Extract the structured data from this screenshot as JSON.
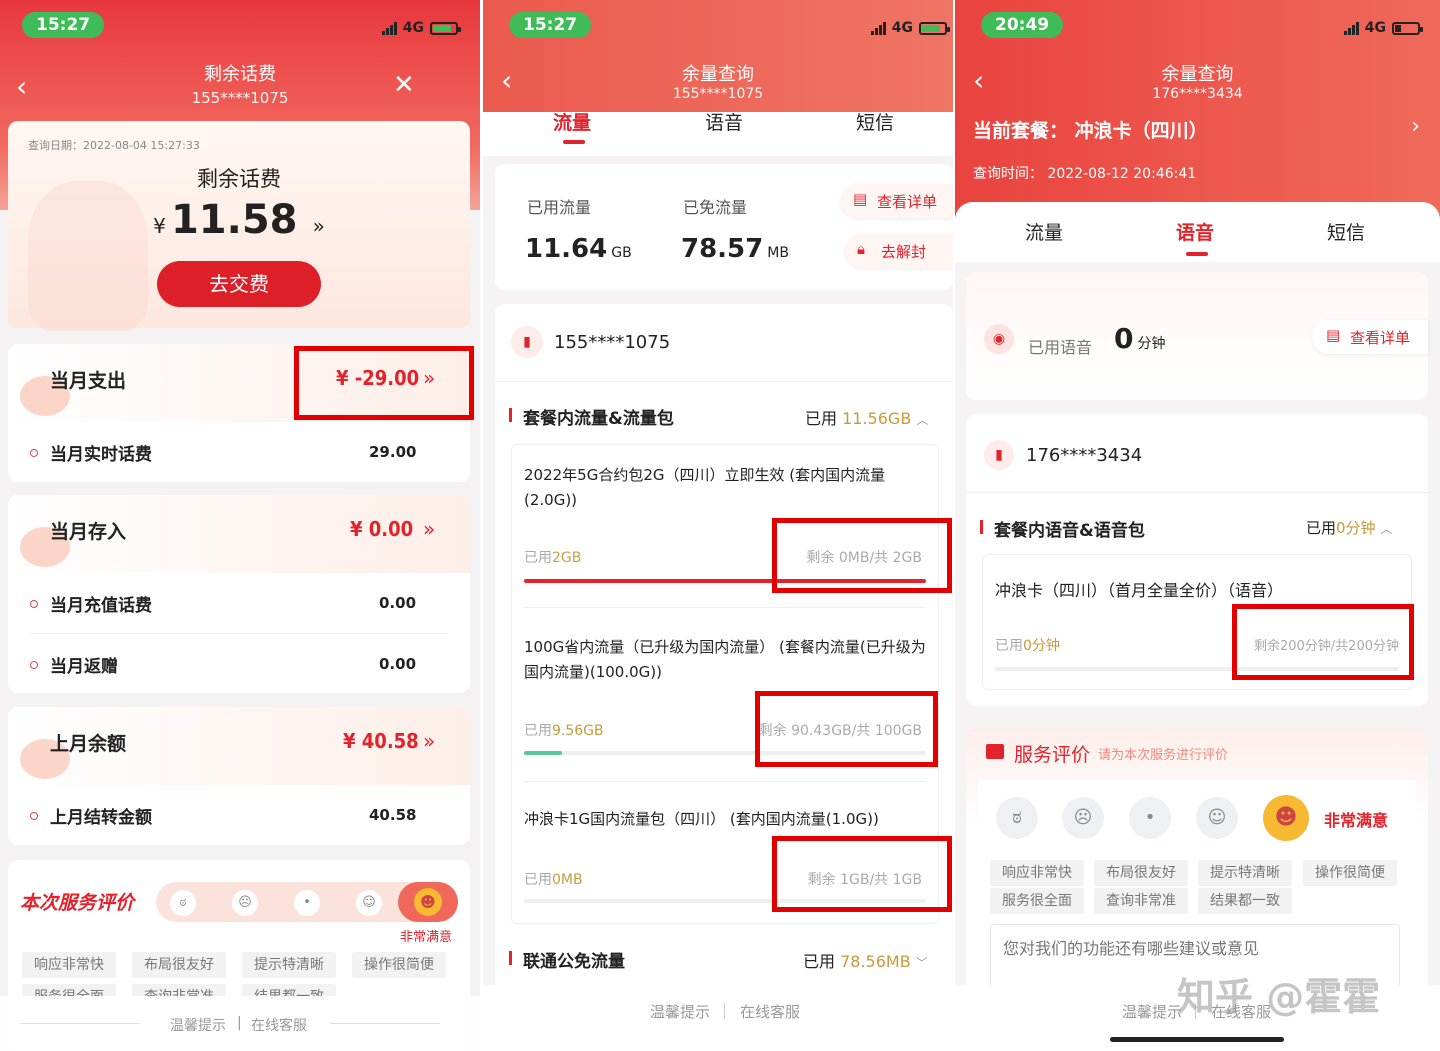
{
  "panel1": {
    "status": {
      "time": "15:27",
      "network": "4G"
    },
    "nav": {
      "title": "剩余话费",
      "number": "155****1075"
    },
    "balance": {
      "query_date": "查询日期：2022-08-04 15:27:33",
      "title": "剩余话费",
      "currency": "¥",
      "amount": "11.58",
      "pay_button": "去交费"
    },
    "expense": {
      "title": "当月支出",
      "amount": "¥  -29.00",
      "items": [
        {
          "label": "当月实时话费",
          "value": "29.00"
        }
      ]
    },
    "deposit": {
      "title": "当月存入",
      "amount": "¥  0.00",
      "items": [
        {
          "label": "当月充值话费",
          "value": "0.00"
        },
        {
          "label": "当月返赠",
          "value": "0.00"
        }
      ]
    },
    "last_month": {
      "title": "上月余额",
      "amount": "¥  40.58",
      "items": [
        {
          "label": "上月结转金额",
          "value": "40.58"
        }
      ]
    },
    "rating": {
      "title": "本次服务评价",
      "selected_label": "非常满意",
      "tags": [
        "响应非常快",
        "布局很友好",
        "提示特清晰",
        "操作很简便",
        "服务很全面",
        "查询非常准",
        "结果都一致"
      ]
    },
    "footer": {
      "tip": "温馨提示",
      "divider": "|",
      "service": "在线客服"
    }
  },
  "panel2": {
    "status": {
      "time": "15:27",
      "network": "4G"
    },
    "nav": {
      "title": "余量查询",
      "number": "155****1075"
    },
    "tabs": [
      "流量",
      "语音",
      "短信"
    ],
    "summary": {
      "used_label": "已用流量",
      "used_value": "11.64",
      "used_unit": "GB",
      "free_label": "已免流量",
      "free_value": "78.57",
      "free_unit": "MB",
      "detail_button": "查看详单",
      "unlock_button": "去解封"
    },
    "number": "155****1075",
    "section": {
      "title": "套餐内流量&流量包",
      "used_label": "已用",
      "used_value": "11.56GB"
    },
    "packages": [
      {
        "name": "2022年5G合约包2G（四川）立即生效 (套内国内流量(2.0G))",
        "used_label": "已用",
        "used_value": "2GB",
        "remain": "剩余 0MB/共 2GB",
        "ratio": 1.0,
        "color": "#e3232c"
      },
      {
        "name": "100G省内流量（已升级为国内流量） (套餐内流量(已升级为国内流量)(100.0G))",
        "used_label": "已用",
        "used_value": "9.56GB",
        "remain": "剩余 90.43GB/共 100GB",
        "ratio": 0.0956,
        "color": "#5cc59a"
      },
      {
        "name": "冲浪卡1G国内流量包（四川） (套内国内流量(1.0G))",
        "used_label": "已用",
        "used_value": "0MB",
        "remain": "剩余 1GB/共 1GB",
        "ratio": 0,
        "color": "#e3232c"
      }
    ],
    "section2": {
      "title": "联通公免流量",
      "used_label": "已用",
      "used_value": "78.56MB"
    },
    "footer": {
      "tip": "温馨提示",
      "service": "在线客服"
    }
  },
  "panel3": {
    "status": {
      "time": "20:49",
      "network": "4G"
    },
    "nav": {
      "title": "余量查询",
      "number": "176****3434"
    },
    "plan": {
      "label": "当前套餐：",
      "name": "冲浪卡（四川）"
    },
    "query_time": "查询时间：  2022-08-12 20:46:41",
    "tabs": [
      "流量",
      "语音",
      "短信"
    ],
    "summary": {
      "used_label": "已用语音",
      "used_value": "0",
      "used_unit": "分钟",
      "detail_button": "查看详单"
    },
    "number": "176****3434",
    "section": {
      "title": "套餐内语音&语音包",
      "used_label": "已用",
      "used_value": "0分钟"
    },
    "package": {
      "name": "冲浪卡（四川）（首月全量全价）（语音）",
      "used_label": "已用",
      "used_value": "0分钟",
      "remain": "剩余200分钟/共200分钟"
    },
    "rating": {
      "title": "服务评价",
      "hint": "请为本次服务进行评价",
      "selected_label": "非常满意",
      "tags": [
        "响应非常快",
        "布局很友好",
        "提示特清晰",
        "操作很简便",
        "服务很全面",
        "查询非常准",
        "结果都一致"
      ],
      "placeholder": "您对我们的功能还有哪些建议或意见"
    },
    "watermark": "知乎 @霍霍",
    "footer": {
      "tip": "温馨提示",
      "service": "在线客服"
    }
  },
  "colors": {
    "brand_red": "#e3232c",
    "highlight_box": "#e30000",
    "gold": "#c89a3b",
    "green": "#3fbb57"
  }
}
